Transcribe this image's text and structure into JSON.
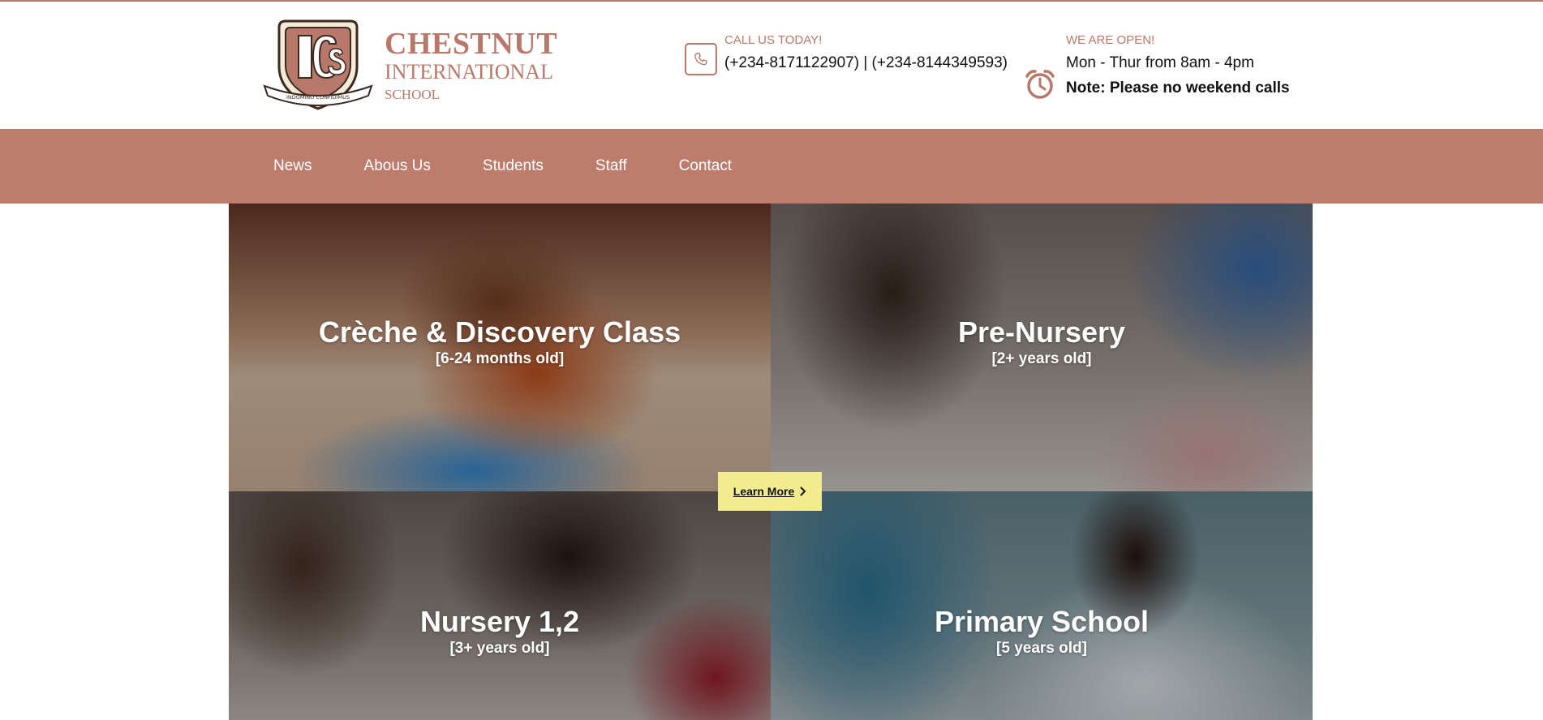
{
  "brand": {
    "line1": "CHESTNUT",
    "line2": "INTERNATIONAL",
    "line3": "SCHOOL",
    "crest_initials": "ICS",
    "crest_motto": "INDOMINO CONFIDIMUS",
    "accent_color": "#b8786a"
  },
  "contact": {
    "label": "CALL US TODAY!",
    "phones": "(+234-8171122907) | (+234-8144349593)",
    "icon": "phone-icon"
  },
  "hours": {
    "label": "WE ARE OPEN!",
    "days": "Mon - Thur from 8am - 4pm",
    "note": "Note: Please no weekend calls",
    "icon": "alarm-clock-icon"
  },
  "nav": {
    "bar_color": "#be7d6c",
    "items": [
      "News",
      "Abous Us",
      "Students",
      "Staff",
      "Contact"
    ]
  },
  "classes": [
    {
      "title": "Crèche & Discovery Class",
      "age": "[6-24 months old]"
    },
    {
      "title": "Pre-Nursery",
      "age": "[2+ years old]"
    },
    {
      "title": "Nursery 1,2",
      "age": "[3+ years old]"
    },
    {
      "title": "Primary School",
      "age": "[5 years old]"
    }
  ],
  "cta": {
    "label": "Learn More",
    "icon": "chevron-right-icon",
    "color": "#f2ec8f"
  }
}
